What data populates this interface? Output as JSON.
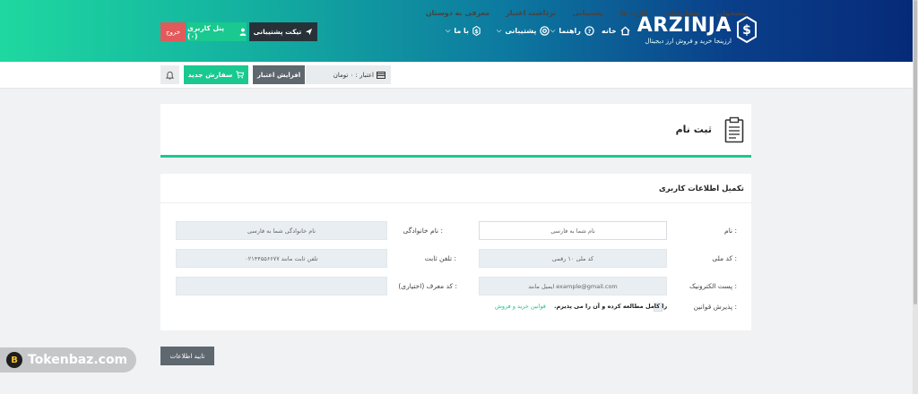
{
  "brand": {
    "name": "ARZINJA",
    "tagline": "ارزینجا خرید و فروش ارز دیجیتال",
    "accent": "#19c98f"
  },
  "topnav": {
    "home": "خانه",
    "guide": "راهنما",
    "support": "پشتیبانی",
    "with_us": "با ما"
  },
  "header_buttons": {
    "ticket": "تیکت پشتیبانی",
    "panel": "پنل کاربری (۰)",
    "logout": "خروج"
  },
  "subnav": {
    "items": [
      "پیشخوان",
      "سفارشات",
      "کارت ها",
      "پشتیبانی",
      "برداشت اعتبار",
      "معرفی به دوستان"
    ]
  },
  "credit": {
    "text": "اعتبار : ۰ تومان"
  },
  "subbar_buttons": {
    "increase": "افزایش اعتبار",
    "new_order": "سفارش جدید"
  },
  "page": {
    "title": "ثبت نام"
  },
  "form": {
    "heading": "تکمیل اطلاعات کاربری",
    "name_label": "نام :",
    "name_placeholder": "نام شما به فارسی",
    "family_label": "نام خانوادگی :",
    "family_placeholder": "نام خانوادگی شما به فارسی",
    "national_label": "کد ملی :",
    "national_placeholder": "کد ملی ۱۰ رقمی",
    "phone_label": "تلفن ثابت :",
    "phone_placeholder": "تلفن ثابت مانند ۰۲۱۴۴۵۵۶۶۷۷",
    "email_label": "پست الکترونیک :",
    "email_placeholder": "ایمیل مانند example@gmail.com",
    "referral_label": "کد معرف (اختیاری) :",
    "referral_placeholder": "",
    "rules_label": "پذیرش قوانین :",
    "rules_link": "قوانین خرید و فروش",
    "rules_text": "را کامل مطالعه کرده و آن را می پذیرم.",
    "submit": "تایید اطلاعات"
  },
  "watermark": {
    "text": "Tokenbaz.com",
    "coin_letter": "B"
  }
}
